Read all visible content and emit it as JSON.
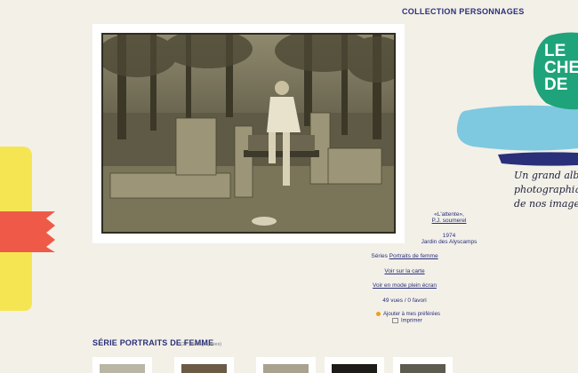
{
  "header": {
    "collection_title": "COLLECTION PERSONNAGES"
  },
  "logo": {
    "line1": "LE",
    "line2": "CHE",
    "line3": "DE"
  },
  "tagline": {
    "line1": "Un grand albu",
    "line2": "photographique",
    "line3": "de nos images"
  },
  "photo": {
    "alt": ""
  },
  "details": {
    "title": "«L'attente»,",
    "author": "P.J. soumerel",
    "year": "1974",
    "place": "Jardin des Alyscamps",
    "series_prefix": "Séries",
    "series_link": "Portraits de femme",
    "map_link": "Voir sur la carte",
    "fullscreen_link": "Voir en mode plein écran",
    "stats": "49 vues / 0 favori",
    "favorite_label": "Ajouter à mes préférées",
    "print_label": "Imprimer"
  },
  "serie": {
    "title": "SÉRIE PORTRAITS DE FEMME",
    "count": "(22 photographies)"
  },
  "colors": {
    "accent": "#2a2f7a",
    "background": "#f3f0e8",
    "yellow": "#f6e552",
    "red": "#ef5a48",
    "blue": "#7ec9e0",
    "green": "#1fa37a"
  }
}
